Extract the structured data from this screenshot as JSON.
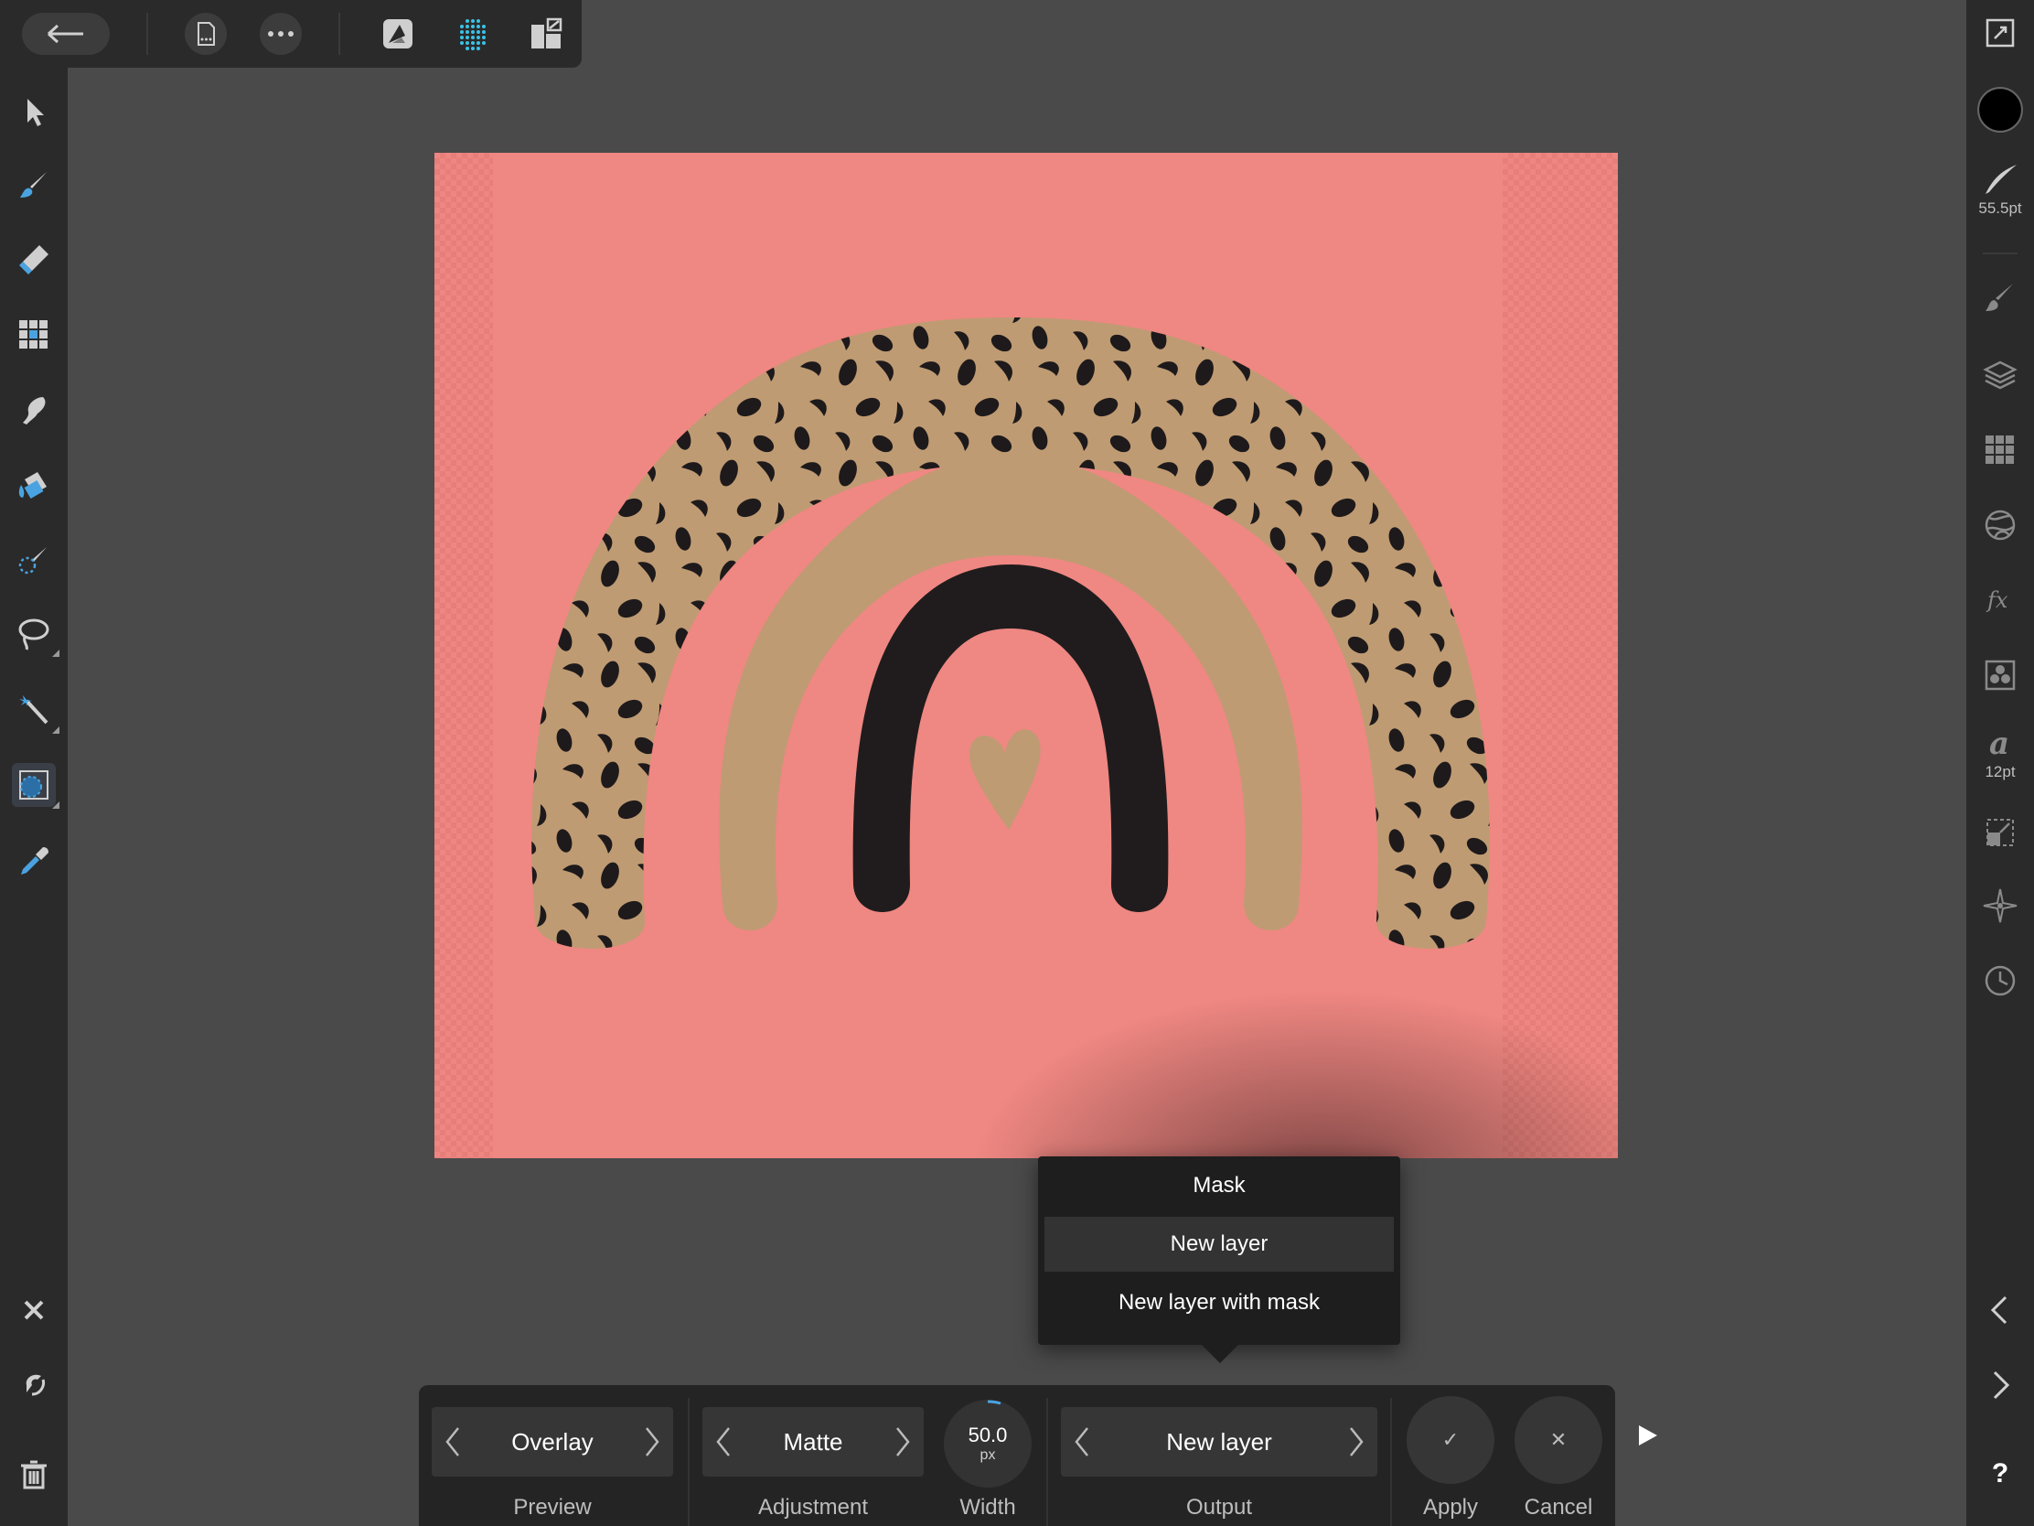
{
  "right_bar": {
    "brush_width": "55.5pt",
    "font_size": "12pt",
    "help": "?"
  },
  "popup_menu": {
    "items": [
      "Mask",
      "New layer",
      "New layer with mask"
    ],
    "selected": "New layer"
  },
  "context_toolbar": {
    "preview": {
      "value": "Overlay",
      "label": "Preview"
    },
    "adjustment": {
      "value": "Matte",
      "label": "Adjustment"
    },
    "width": {
      "value": "50.0",
      "unit": "px",
      "label": "Width"
    },
    "output": {
      "value": "New layer",
      "label": "Output"
    },
    "apply": {
      "icon": "✓",
      "label": "Apply"
    },
    "cancel": {
      "icon": "✕",
      "label": "Cancel"
    }
  },
  "colors": {
    "canvas_background": "#ef8782",
    "rainbow_tan": "#bf9b73",
    "rainbow_black": "#201c1d",
    "accent_grid_icon": "#39c3e6"
  }
}
